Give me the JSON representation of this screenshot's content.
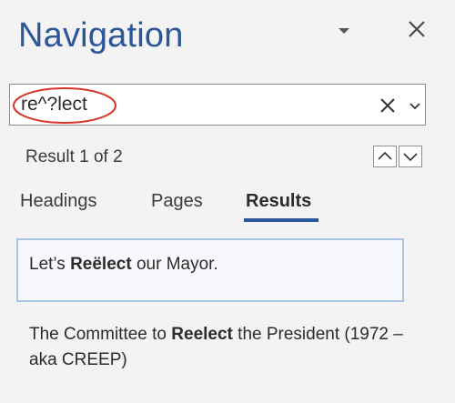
{
  "pane": {
    "title": "Navigation"
  },
  "search": {
    "value": "re^?lect",
    "highlight_color": "#d9352b"
  },
  "results_nav": {
    "count_text": "Result 1 of 2"
  },
  "tabs": [
    {
      "label": "Headings",
      "selected": false
    },
    {
      "label": "Pages",
      "selected": false
    },
    {
      "label": "Results",
      "selected": true
    }
  ],
  "results": [
    {
      "before": "Let’s ",
      "match": "Reëlect",
      "after": " our Mayor."
    },
    {
      "before": "The Committee to ",
      "match": "Reelect",
      "after": " the President (1972 – aka CREEP)"
    }
  ],
  "colors": {
    "accent": "#2b579a",
    "selected_border": "#a9c4e6"
  },
  "icons": [
    "pane-options-icon",
    "close-icon",
    "clear-icon",
    "chevron-down-icon",
    "chevron-up-icon"
  ]
}
